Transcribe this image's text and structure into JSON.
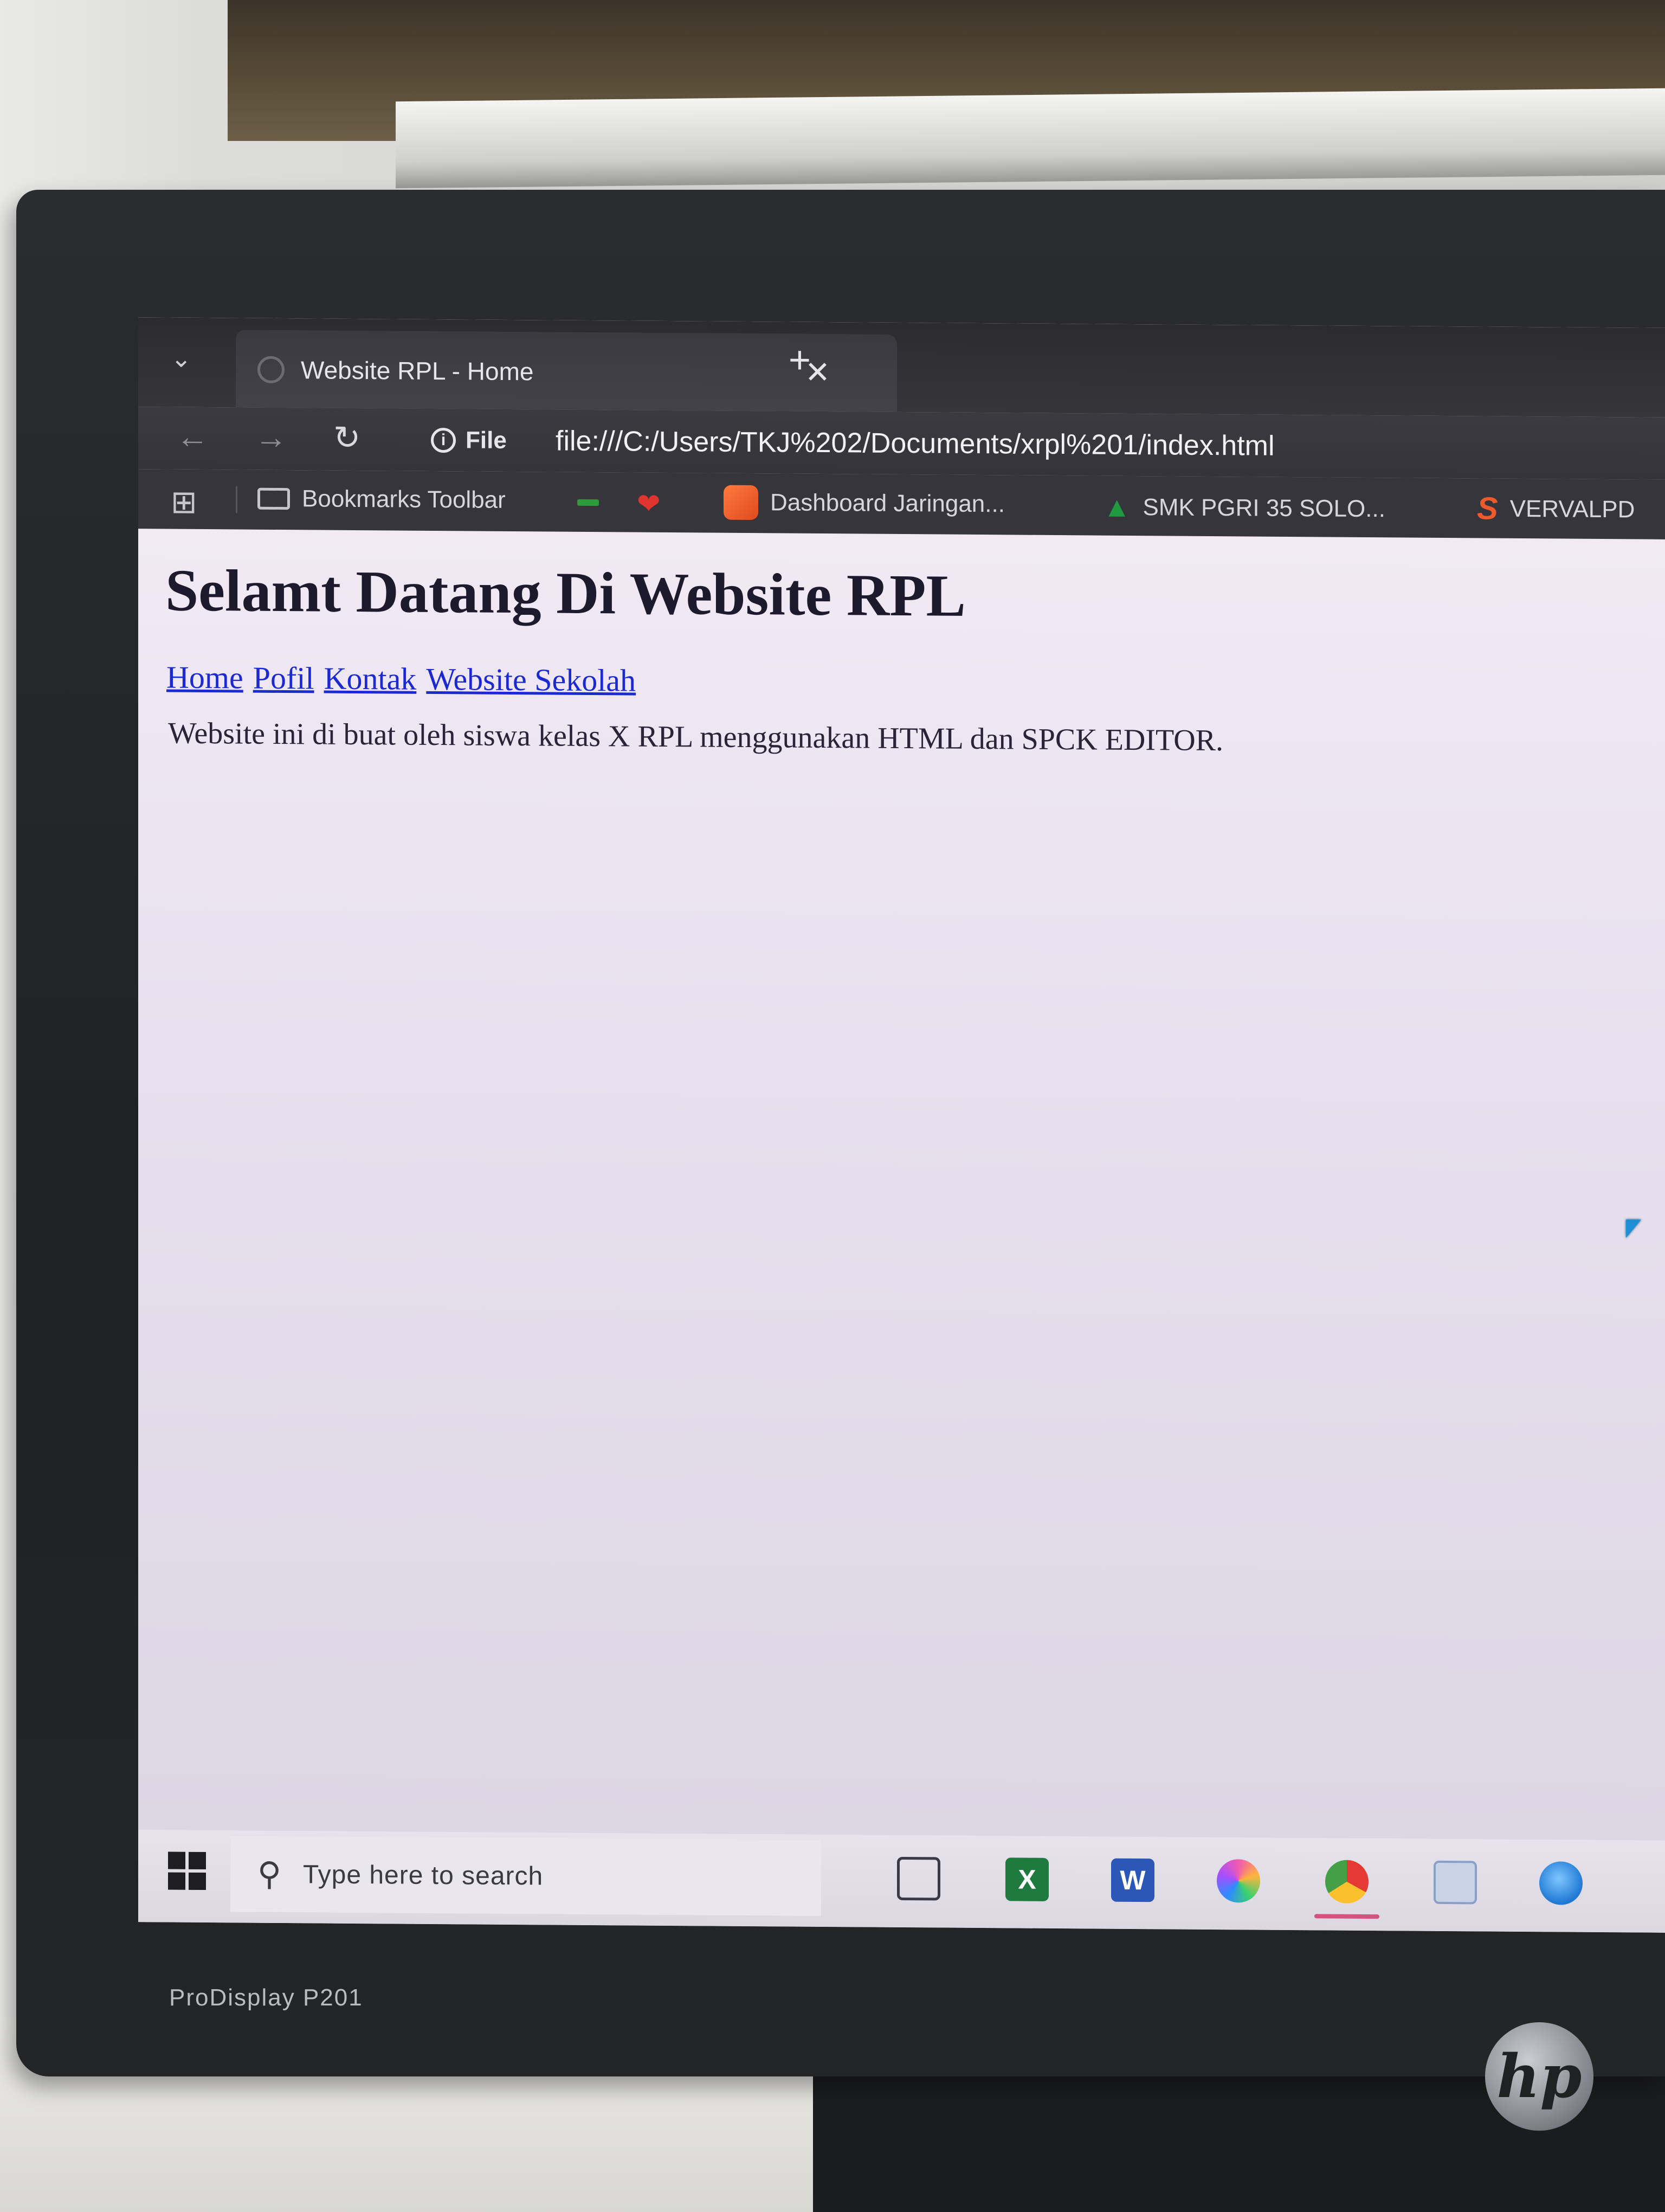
{
  "browser": {
    "tab": {
      "title": "Website RPL - Home",
      "close": "✕",
      "new_tab": "+"
    },
    "nav": {
      "back": "←",
      "forward": "→",
      "reload": "↻",
      "site_label": "File",
      "url": "file:///C:/Users/TKJ%202/Documents/xrpl%201/index.html"
    },
    "bookmarks": [
      {
        "label": "Bookmarks Toolbar",
        "icon": "folder-icon"
      },
      {
        "label": "",
        "icon": "green-bookmark-icon"
      },
      {
        "label": "",
        "icon": "heart-icon"
      },
      {
        "label": "Dashboard Jaringan...",
        "icon": "dashboard-icon"
      },
      {
        "label": "SMK PGRI 35 SOLO...",
        "icon": "graduation-cap-icon"
      },
      {
        "label": "VERVALPD",
        "icon": "s-logo-icon"
      }
    ]
  },
  "page": {
    "heading": "Selamt Datang Di Website RPL",
    "links": [
      "Home",
      "Pofil",
      "Kontak",
      "Website Sekolah"
    ],
    "paragraph": "Website ini di buat oleh siswa kelas X RPL menggunakan HTML dan SPCK EDITOR."
  },
  "taskbar": {
    "search_placeholder": "Type here to search",
    "apps": [
      "task-view-icon",
      "excel-icon",
      "word-icon",
      "copilot-icon",
      "chrome-icon",
      "window-icon",
      "edge-icon"
    ],
    "excel_letter": "X",
    "word_letter": "W"
  },
  "monitor": {
    "model": "ProDisplay P201",
    "brand": "hp"
  },
  "colors": {
    "link": "#1b2ad0",
    "heading": "#1e1a2e",
    "browser_chrome": "#35353a"
  }
}
